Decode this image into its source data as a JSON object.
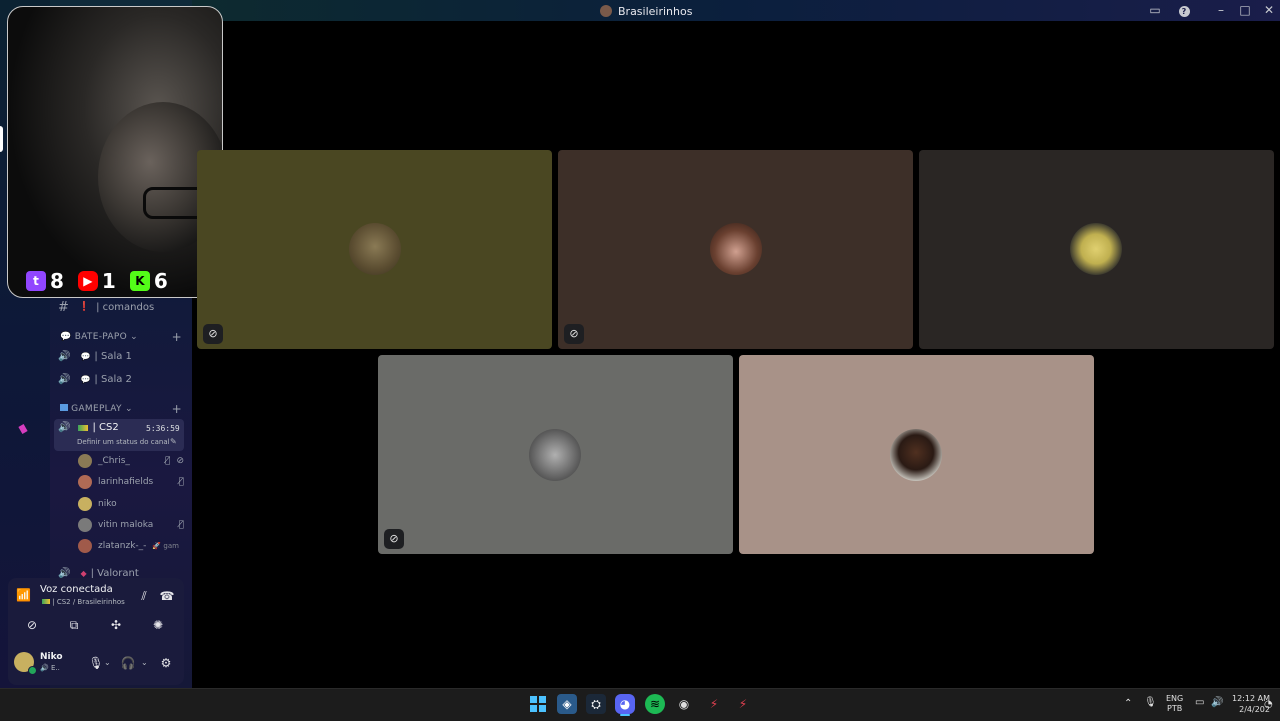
{
  "window": {
    "title": "Brasileirinhos"
  },
  "stream_counters": [
    {
      "platform": "twitch-icon",
      "count": "8",
      "color": "#9146ff"
    },
    {
      "platform": "youtube-icon",
      "count": "1",
      "color": "#ff0000"
    },
    {
      "platform": "kick-icon",
      "count": "6",
      "color": "#53fc18"
    }
  ],
  "channels": {
    "comandos": {
      "prefix": "❗",
      "name": "| comandos"
    },
    "bate_papo": {
      "label": "BATE-PAPO",
      "items": [
        {
          "name": "| Sala 1"
        },
        {
          "name": "| Sala 2"
        }
      ]
    },
    "gameplay": {
      "label": "GAMEPLAY",
      "active": {
        "name": "| CS2",
        "timer": "5:36:59",
        "status": "Definir um status do canal"
      },
      "users": [
        {
          "name": "_Chris_",
          "muted": true,
          "deafened": true
        },
        {
          "name": "larinhafields",
          "muted": true,
          "deafened": false
        },
        {
          "name": "niko",
          "muted": false,
          "deafened": false
        },
        {
          "name": "vitin maloka",
          "muted": true,
          "deafened": false
        },
        {
          "name": "zlatanzk-_-",
          "muted": false,
          "deafened": false,
          "activity": "gam"
        }
      ],
      "next": {
        "name": "| Valorant"
      }
    }
  },
  "voice": {
    "status": "Voz conectada",
    "channel": "| CS2 / Brasileirinhos"
  },
  "user": {
    "name": "Niko",
    "sub": "E.."
  },
  "tiles": [
    {
      "bg": "#4a4722",
      "mic_off": true
    },
    {
      "bg": "#3d2f28",
      "mic_off": true
    },
    {
      "bg": "#2a2624",
      "mic_off": false
    },
    {
      "bg": "#6a6b68",
      "mic_off": true
    },
    {
      "bg": "#a89288",
      "mic_off": false
    }
  ],
  "taskbar": {
    "lang": "ENG",
    "layout": "PTB",
    "time": "12:12 AM",
    "date": "2/4/202"
  }
}
